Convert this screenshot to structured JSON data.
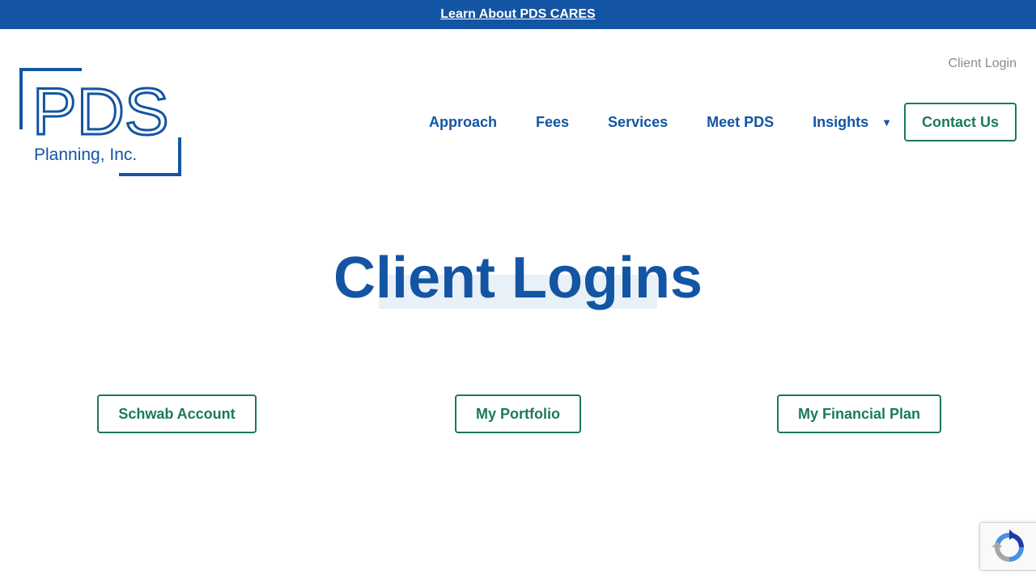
{
  "announcement": {
    "link_text": "Learn About PDS CARES"
  },
  "logo": {
    "text_main": "PDS",
    "text_sub": "Planning, Inc.",
    "color": "#1355a3"
  },
  "header": {
    "client_login": "Client Login",
    "nav": [
      {
        "label": "Approach"
      },
      {
        "label": "Fees"
      },
      {
        "label": "Services"
      },
      {
        "label": "Meet PDS"
      },
      {
        "label": "Insights",
        "caret": "▼"
      }
    ],
    "contact_label": "Contact Us"
  },
  "hero": {
    "title": "Client Logins"
  },
  "logins": [
    {
      "label": "Schwab Account"
    },
    {
      "label": "My Portfolio"
    },
    {
      "label": "My Financial Plan"
    }
  ],
  "colors": {
    "brand_blue": "#1355a3",
    "accent_green": "#1a7a5c"
  },
  "recaptcha": {
    "icon": "recaptcha-icon"
  }
}
